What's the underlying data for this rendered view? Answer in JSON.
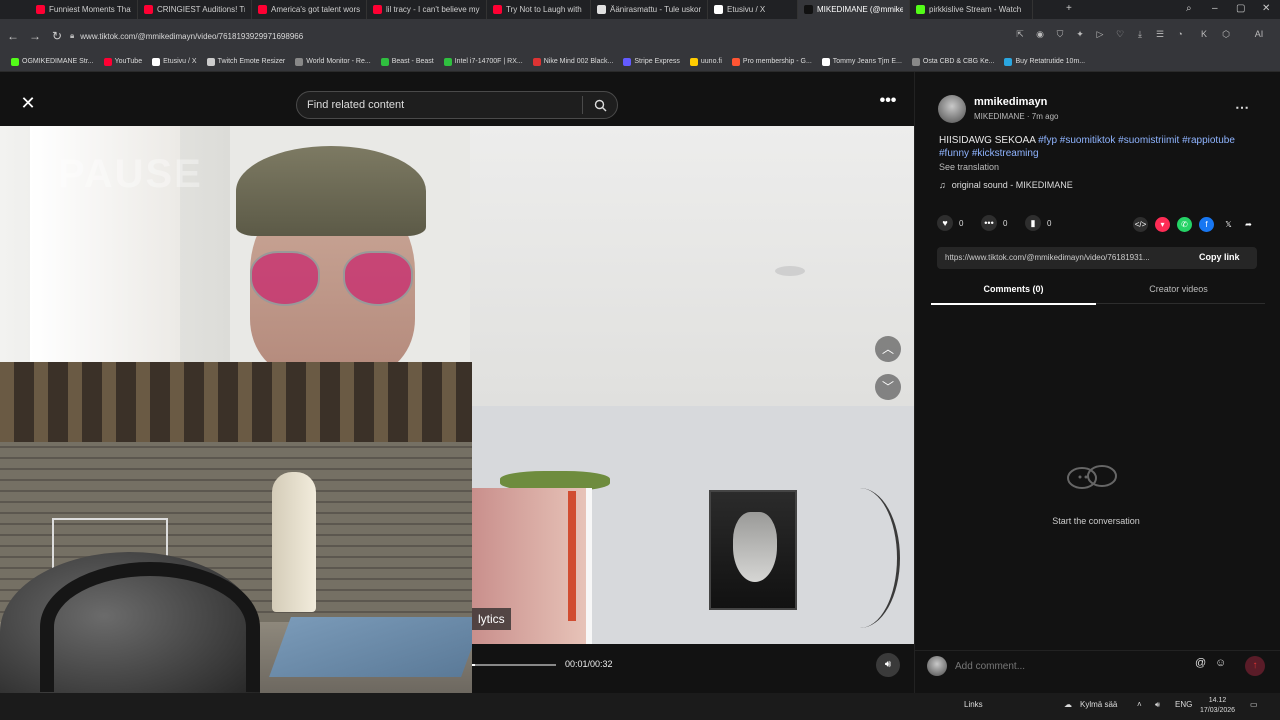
{
  "browser": {
    "tabs": [
      {
        "label": "Funniest Moments That M",
        "color": "#ff0033",
        "active": false
      },
      {
        "label": "CRINGIEST Auditions! Try",
        "color": "#ff0033",
        "active": false
      },
      {
        "label": "America's got talent wors",
        "color": "#ff0033",
        "active": false
      },
      {
        "label": "lil tracy - I can't believe my",
        "color": "#ff0033",
        "active": false
      },
      {
        "label": "Try Not to Laugh with KSI",
        "color": "#ff0033",
        "active": false
      },
      {
        "label": "Äänirasmattu - Tule uskon",
        "color": "#e0e0e0",
        "active": false
      },
      {
        "label": "Etusivu / X",
        "color": "#ffffff",
        "active": false
      },
      {
        "label": "MIKEDIMANE (@mmiked",
        "color": "#111111",
        "active": true
      },
      {
        "label": "pirkkislive Stream - Watch",
        "color": "#53fc18",
        "active": false
      }
    ],
    "url": "www.tiktok.com/@mmikedimayn/video/7618193929971698966",
    "bookmarks": [
      {
        "label": "OGMIKEDIMANE Str...",
        "color": "#53fc18"
      },
      {
        "label": "YouTube",
        "color": "#ff0033"
      },
      {
        "label": "Etusivu / X",
        "color": "#ffffff"
      },
      {
        "label": "Twitch Emote Resizer",
        "color": "#cccccc"
      },
      {
        "label": "World Monitor - Re...",
        "color": "#888888"
      },
      {
        "label": "Beast - Beast",
        "color": "#2fbf3f"
      },
      {
        "label": "Intel i7-14700F | RX...",
        "color": "#2fbf3f"
      },
      {
        "label": "Nike Mind 002 Black...",
        "color": "#dd3333"
      },
      {
        "label": "Stripe Express",
        "color": "#635bff"
      },
      {
        "label": "uuno.fi",
        "color": "#ffcc00"
      },
      {
        "label": "Pro membership - G...",
        "color": "#ff5533"
      },
      {
        "label": "Tommy Jeans Tjm E...",
        "color": "#ffffff"
      },
      {
        "label": "Osta CBD & CBG Ke...",
        "color": "#888888"
      },
      {
        "label": "Buy Retatrutide 10m...",
        "color": "#2aa6e0"
      }
    ]
  },
  "player": {
    "close_icon": "close-icon",
    "search_placeholder": "Find related content",
    "pause_ghost": "PAUSE",
    "analytics_tooltip": "lytics",
    "time": "00:01/00:32",
    "progress_fraction": 0.03
  },
  "panel": {
    "author_name": "mmikedimayn",
    "author_sub": "MIKEDIMANE · 7m ago",
    "caption_text": "HIISIDAWG SEKOAA ",
    "hashtags": [
      "#fyp",
      "#suomitiktok",
      "#suomistriimit",
      "#rappiotube",
      "#funny",
      "#kickstreaming"
    ],
    "see_translation": "See translation",
    "music_icon": "♫",
    "music": "original sound - MIKEDIMANE",
    "likes": "0",
    "comments_count": "0",
    "saves": "0",
    "share_link": "https://www.tiktok.com/@mmikedimayn/video/76181931...",
    "copy_link": "Copy link",
    "tab_comments": "Comments (0)",
    "tab_creator": "Creator videos",
    "empty_text": "Start the conversation",
    "comment_placeholder": "Add comment...",
    "share_colors": {
      "pink": "#fe2c55",
      "whatsapp": "#25d366",
      "facebook": "#1877f2"
    }
  },
  "taskbar": {
    "links": "Links",
    "weather": "Kylmä sää",
    "lang": "ENG",
    "time": "14.12",
    "date": "17/03/2026"
  }
}
